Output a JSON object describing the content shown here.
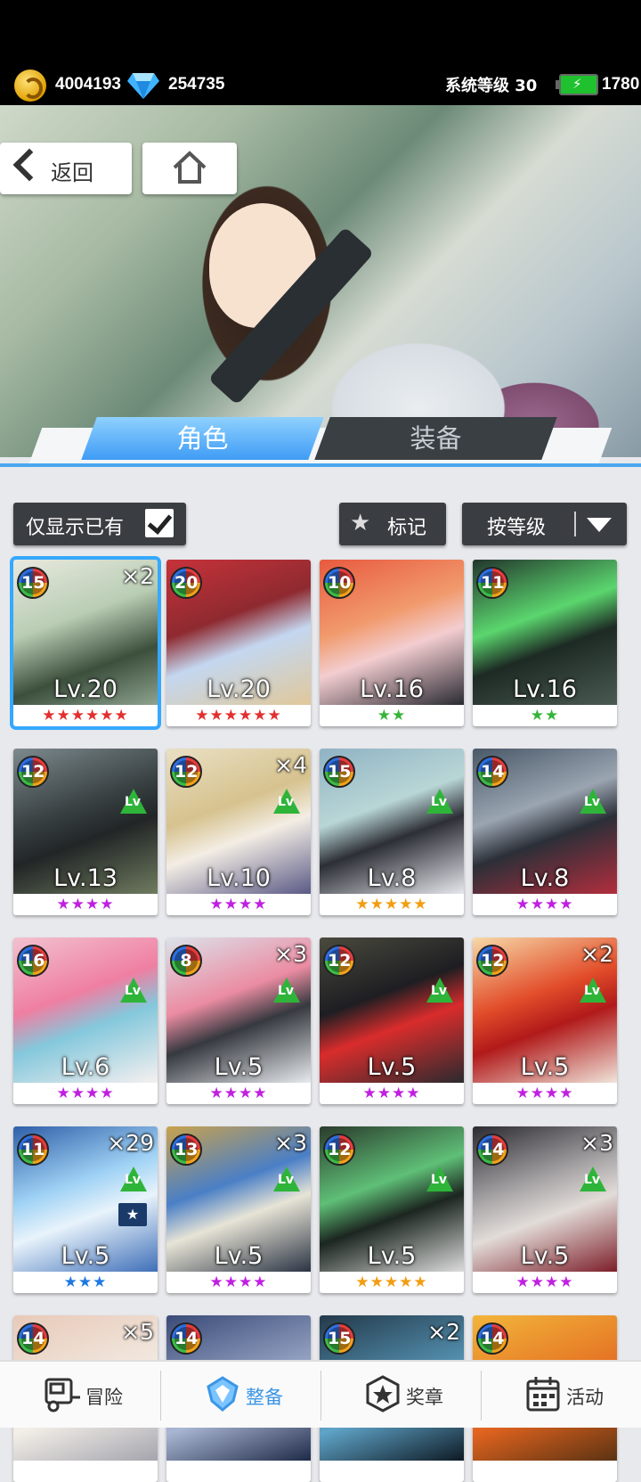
{
  "status": {
    "coins": "4004193",
    "diamonds": "254735",
    "system_level_label": "系统等级 30",
    "energy": "1780"
  },
  "nav": {
    "back_label": "返回"
  },
  "tabs": {
    "character": "角色",
    "equipment": "装备"
  },
  "filters": {
    "owned_only_label": "仅显示已有",
    "owned_only_checked": true,
    "mark_label": "标记",
    "sort_label": "按等级"
  },
  "cards": [
    {
      "badge": "15",
      "count": "×2",
      "level": "Lv.20",
      "stars": "★★★★★★",
      "star_color": "#e23030",
      "lv_up": false,
      "selected": true
    },
    {
      "badge": "20",
      "count": "",
      "level": "Lv.20",
      "stars": "★★★★★★",
      "star_color": "#e23030",
      "lv_up": false,
      "selected": false
    },
    {
      "badge": "10",
      "count": "",
      "level": "Lv.16",
      "stars": "★★",
      "star_color": "#35b43a",
      "lv_up": false,
      "selected": false
    },
    {
      "badge": "11",
      "count": "",
      "level": "Lv.16",
      "stars": "★★",
      "star_color": "#35b43a",
      "lv_up": false,
      "selected": false
    },
    {
      "badge": "12",
      "count": "",
      "level": "Lv.13",
      "stars": "★★★★",
      "star_color": "#c020e0",
      "lv_up": true,
      "selected": false
    },
    {
      "badge": "12",
      "count": "×4",
      "level": "Lv.10",
      "stars": "★★★★",
      "star_color": "#c020e0",
      "lv_up": true,
      "selected": false
    },
    {
      "badge": "15",
      "count": "",
      "level": "Lv.8",
      "stars": "★★★★★",
      "star_color": "#f29d12",
      "lv_up": true,
      "selected": false
    },
    {
      "badge": "14",
      "count": "",
      "level": "Lv.8",
      "stars": "★★★★",
      "star_color": "#c020e0",
      "lv_up": true,
      "selected": false
    },
    {
      "badge": "16",
      "count": "",
      "level": "Lv.6",
      "stars": "★★★★",
      "star_color": "#c020e0",
      "lv_up": true,
      "selected": false
    },
    {
      "badge": "8",
      "count": "×3",
      "level": "Lv.5",
      "stars": "★★★★",
      "star_color": "#c020e0",
      "lv_up": true,
      "selected": false
    },
    {
      "badge": "12",
      "count": "",
      "level": "Lv.5",
      "stars": "★★★★",
      "star_color": "#c020e0",
      "lv_up": true,
      "selected": false
    },
    {
      "badge": "12",
      "count": "×2",
      "level": "Lv.5",
      "stars": "★★★★",
      "star_color": "#c020e0",
      "lv_up": true,
      "selected": false
    },
    {
      "badge": "11",
      "count": "×29",
      "level": "Lv.5",
      "stars": "★★★",
      "star_color": "#1f78e0",
      "lv_up": true,
      "star_up": true,
      "selected": false
    },
    {
      "badge": "13",
      "count": "×3",
      "level": "Lv.5",
      "stars": "★★★★",
      "star_color": "#c020e0",
      "lv_up": true,
      "selected": false
    },
    {
      "badge": "12",
      "count": "",
      "level": "Lv.5",
      "stars": "★★★★★",
      "star_color": "#f29d12",
      "lv_up": true,
      "selected": false
    },
    {
      "badge": "14",
      "count": "×3",
      "level": "Lv.5",
      "stars": "★★★★",
      "star_color": "#c020e0",
      "lv_up": true,
      "selected": false
    },
    {
      "badge": "14",
      "count": "×5",
      "level": "",
      "stars": "",
      "star_color": "#c020e0",
      "lv_up": false,
      "selected": false
    },
    {
      "badge": "14",
      "count": "",
      "level": "",
      "stars": "",
      "star_color": "#c020e0",
      "lv_up": false,
      "selected": false
    },
    {
      "badge": "15",
      "count": "×2",
      "level": "",
      "stars": "",
      "star_color": "#c020e0",
      "lv_up": false,
      "selected": false
    },
    {
      "badge": "14",
      "count": "",
      "level": "",
      "stars": "",
      "star_color": "#c020e0",
      "lv_up": false,
      "selected": false
    }
  ],
  "card_art": [
    "linear-gradient(160deg,#e8e9df,#b9cdb4 40%,#3b4f3c 70%,#8ea38f)",
    "linear-gradient(160deg,#c7323a,#8e2a30 40%,#c4d7f0 60%,#e0c89a)",
    "linear-gradient(160deg,#e85a3f,#f19a6d 40%,#f3cdd0 60%,#2a2a32)",
    "linear-gradient(160deg,#22352c,#5bd66e 40%,#1d2a24 60%,#4a5a52)",
    "linear-gradient(160deg,#7d8a8e,#3a4244 40%,#212526 60%,#6f7b5f)",
    "linear-gradient(160deg,#e9e0c4,#d6c28e 40%,#f3ede4 60%,#5b5a86)",
    "linear-gradient(160deg,#8fb3c4,#b9d6d6 40%,#2d2f36 60%,#e6e8ee)",
    "linear-gradient(160deg,#495868,#9aa5b1 40%,#2b2f38 60%,#b22e3d)",
    "linear-gradient(160deg,#f2c1d0,#ef7fa2 40%,#84c8dc 60%,#f6f0f0)",
    "linear-gradient(160deg,#dbe2ea,#eb8ca2 40%,#36393f 60%,#e7ebef)",
    "linear-gradient(160deg,#4a4a3e,#1e1e22 40%,#d92c2c 60%,#2a2a2e)",
    "linear-gradient(160deg,#f6d9a8,#e24d2a 40%,#b11a1a 60%,#f0e4da)",
    "linear-gradient(160deg,#2f5fa8,#9fd2f5 40%,#e8f3fb 60%,#3f6fb8)",
    "linear-gradient(160deg,#c9a24e,#4a7fc6 40%,#e7e4d6 60%,#2b3444)",
    "linear-gradient(160deg,#2a3b2c,#5fbf77 40%,#1c2620 60%,#dcdcdc)",
    "linear-gradient(160deg,#2b2a30,#a8a5a7 40%,#e2dcd8 60%,#7d1f2a)",
    "linear-gradient(160deg,#e8c9b8,#f3efe8 60%,#a4a4ad)",
    "linear-gradient(160deg,#3a4b78,#a9b6d3 60%,#1e2a48)",
    "linear-gradient(160deg,#233a4a,#5fa4c8 60%,#0e1a24)",
    "linear-gradient(160deg,#f2b53a,#e2641f 60%,#5a3212)"
  ],
  "bottom_nav": [
    {
      "label": "冒险",
      "icon": "truck-icon",
      "active": false
    },
    {
      "label": "整备",
      "icon": "crystal-icon",
      "active": true
    },
    {
      "label": "奖章",
      "icon": "medal-icon",
      "active": false
    },
    {
      "label": "活动",
      "icon": "calendar-icon",
      "active": false
    }
  ]
}
